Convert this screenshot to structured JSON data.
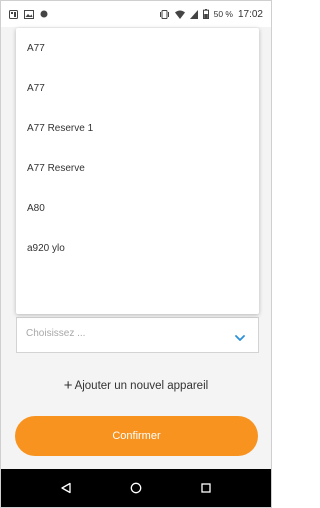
{
  "status_bar": {
    "battery": "50 %",
    "time": "17:02"
  },
  "dropdown": {
    "options": [
      "A77",
      "A77",
      "A77 Reserve 1",
      "A77 Reserve",
      "A80",
      "a920 ylo"
    ]
  },
  "select": {
    "placeholder": "Choisissez ..."
  },
  "add_device_label": "Ajouter un nouvel appareil",
  "confirm_label": "Confirmer",
  "colors": {
    "accent": "#f7931e",
    "chevron": "#2b8fd6"
  }
}
